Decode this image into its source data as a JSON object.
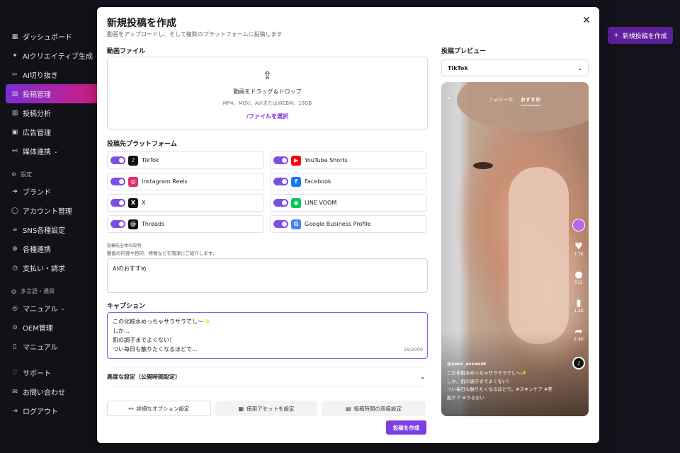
{
  "sidebar": {
    "items": [
      {
        "label": "ダッシュボード",
        "icon": "grid-icon"
      },
      {
        "label": "AIクリエイティブ生成",
        "icon": "sparkle-icon"
      },
      {
        "label": "AI切り抜き",
        "icon": "scissors-icon"
      },
      {
        "label": "投稿管理",
        "icon": "post-icon",
        "active": true
      },
      {
        "label": "投稿分析",
        "icon": "chart-icon"
      },
      {
        "label": "広告管理",
        "icon": "ad-icon"
      },
      {
        "label": "媒体連携",
        "icon": "link-icon"
      }
    ],
    "settings_section": "設定",
    "settings_items": [
      {
        "label": "ブランド",
        "icon": "brand-icon"
      },
      {
        "label": "アカウント管理",
        "icon": "user-icon"
      },
      {
        "label": "SNS各種設定",
        "icon": "infinity-icon"
      },
      {
        "label": "各種連携",
        "icon": "connect-icon"
      },
      {
        "label": "支払い・請求",
        "icon": "payment-icon"
      }
    ],
    "lang_section": "多言語・通貨",
    "lang_items": [
      {
        "label": "マニュアル",
        "icon": "manual-icon"
      },
      {
        "label": "OEM管理",
        "icon": "oem-icon"
      },
      {
        "label": "マニュアル",
        "icon": "book-icon"
      }
    ],
    "bottom_items": [
      {
        "label": "サポート",
        "icon": "support-icon"
      },
      {
        "label": "お問い合わせ",
        "icon": "mail-icon"
      },
      {
        "label": "ログアウト",
        "icon": "logout-icon"
      }
    ]
  },
  "header": {
    "new_post_label": "新規投稿を作成"
  },
  "modal": {
    "title": "新規投稿を作成",
    "subtitle": "動画をアップロードし、そして複数のプラットフォームに投稿します",
    "video_label": "動画ファイル",
    "dropzone": {
      "main": "動画をドラッグ＆ドロップ",
      "sub": "MP4、MOV、AVIまたはWEBM、10GB",
      "link": "/ファイルを選択"
    },
    "platforms_label": "投稿先プラットフォーム",
    "platforms": [
      {
        "name": "TikTok",
        "color": "#111111",
        "glyph": "♪",
        "enabled": true
      },
      {
        "name": "YouTube Shorts",
        "color": "#ff0000",
        "glyph": "▶",
        "enabled": true
      },
      {
        "name": "Instagram Reels",
        "color": "#e1306c",
        "glyph": "◎",
        "enabled": true
      },
      {
        "name": "Facebook",
        "color": "#1877f2",
        "glyph": "f",
        "enabled": true
      },
      {
        "name": "X",
        "color": "#111111",
        "glyph": "X",
        "enabled": true
      },
      {
        "name": "LINE VOOM",
        "color": "#06c755",
        "glyph": "◉",
        "enabled": true
      },
      {
        "name": "Threads",
        "color": "#111111",
        "glyph": "@",
        "enabled": true
      },
      {
        "name": "Google Business Profile",
        "color": "#4285f4",
        "glyph": "G",
        "enabled": true
      }
    ],
    "description_label": "投稿先全体の説明",
    "description_help": "動画の内容や目的、特徴などを簡潔にご紹介します。",
    "description_value": "AIのおすすめ",
    "caption_label": "キャプション",
    "caption_lines": [
      "この化粧水めっちゃサラサラでし〜✨",
      "しか…",
      "肌の調子までよくない！",
      "つい毎日も触りたくなるほどで…"
    ],
    "caption_counter": "55/2000",
    "advanced_label": "高度な設定（公開時間設定）",
    "buttons": {
      "detail_options": "詳細なオプション設定",
      "assets": "使用アセットを設定",
      "schedule": "投稿時間の高度設定",
      "submit": "投稿を作成"
    }
  },
  "preview": {
    "label": "投稿プレビュー",
    "selected_platform": "TikTok",
    "tabs": {
      "following": "フォロー中",
      "recommended": "おすすめ"
    },
    "likes": "7.7K",
    "comments": "512",
    "saves": "1.2K",
    "shares": "2.4K",
    "account": "@your_account",
    "caption_lines": [
      "この化粧水めっちゃサラサラでし〜✨",
      "しか、肌の調子までよくない！",
      "つい毎日も触りたくなるほどで。#スキンケア #美",
      "肌ケア #うるおい"
    ]
  }
}
